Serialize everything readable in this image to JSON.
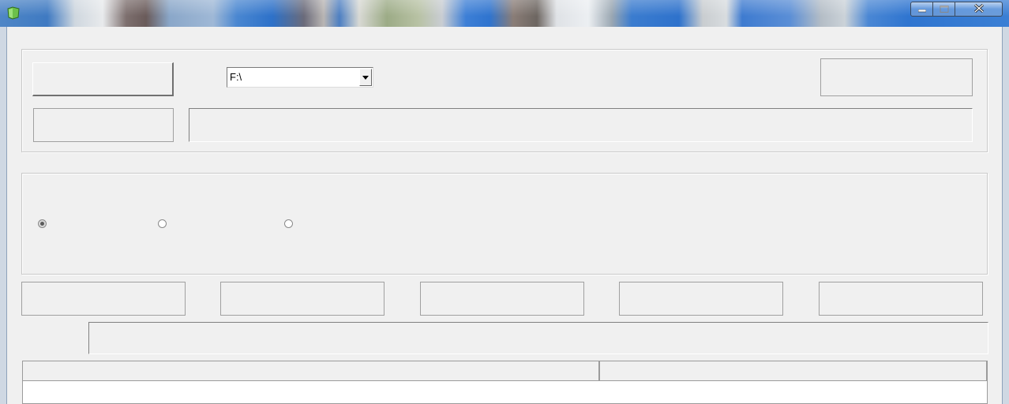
{
  "window": {
    "title": "",
    "controls": {
      "minimize": "minimize-icon",
      "maximize": "maximize-icon",
      "close": "close-icon"
    }
  },
  "source_group": {
    "drive_combo": {
      "selected": "F:\\"
    }
  },
  "options_group": {
    "radios": [
      {
        "label": "",
        "checked": true
      },
      {
        "label": "",
        "checked": false
      },
      {
        "label": "",
        "checked": false
      }
    ]
  },
  "list": {
    "columns": [
      "",
      ""
    ]
  },
  "colors": {
    "window_bg": "#f0f0f0",
    "title_accent": "#2f74cf"
  }
}
